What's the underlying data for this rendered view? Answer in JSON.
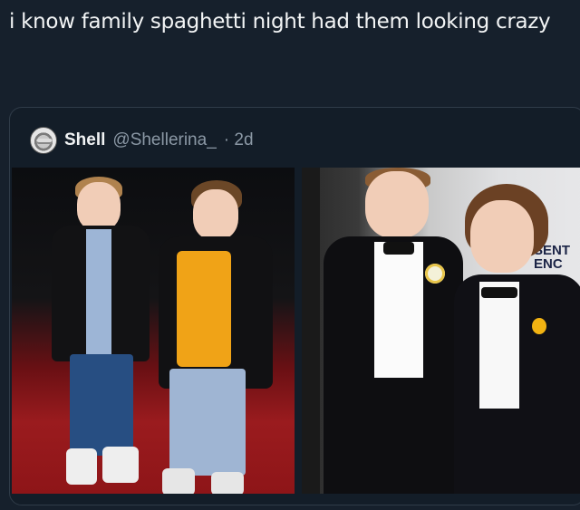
{
  "caption": "i know family spaghetti night had them looking crazy",
  "quoted_post": {
    "author_name": "Shell",
    "author_handle": "@Shellerina_",
    "time": "· 2d",
    "avatar_icon": "avatar-icon"
  },
  "photos": {
    "right_sign_text": "SENT\nENC"
  },
  "colors": {
    "background": "#16202c",
    "card_border": "#2f3b48",
    "muted_text": "#8b98a5"
  }
}
